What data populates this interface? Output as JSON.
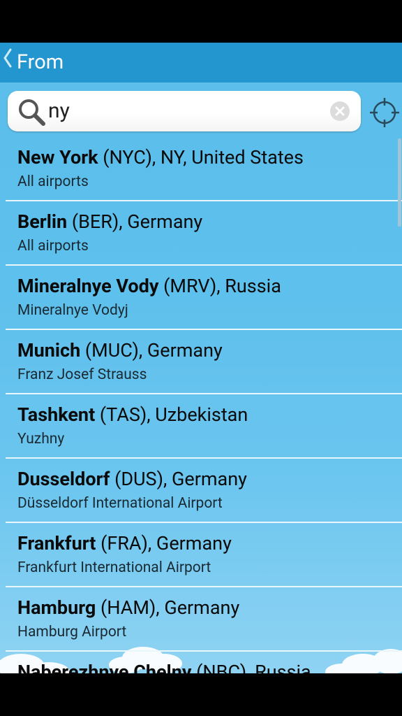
{
  "actionbar": {
    "title": "From"
  },
  "search": {
    "value": "ny"
  },
  "results": [
    {
      "city": "New York",
      "rest": " (NYC), NY, United States",
      "sub": "All airports"
    },
    {
      "city": "Berlin",
      "rest": " (BER), Germany",
      "sub": "All airports"
    },
    {
      "city": "Mineralnye Vody",
      "rest": " (MRV), Russia",
      "sub": "Mineralnye Vodyj"
    },
    {
      "city": "Munich",
      "rest": " (MUC), Germany",
      "sub": "Franz Josef Strauss"
    },
    {
      "city": "Tashkent",
      "rest": " (TAS), Uzbekistan",
      "sub": "Yuzhny"
    },
    {
      "city": "Dusseldorf",
      "rest": " (DUS), Germany",
      "sub": "Düsseldorf International Airport"
    },
    {
      "city": "Frankfurt",
      "rest": " (FRA), Germany",
      "sub": "Frankfurt International Airport"
    },
    {
      "city": "Hamburg",
      "rest": " (HAM), Germany",
      "sub": "Hamburg Airport"
    },
    {
      "city": "Naberezhnye Chelny",
      "rest": " (NBC), Russia",
      "sub": ""
    }
  ],
  "icons": {
    "back": "chevron-left-icon",
    "search": "search-icon",
    "clear": "clear-icon",
    "locate": "crosshair-icon"
  },
  "colors": {
    "actionbar": "#2496cf",
    "background": "#5ec0ec",
    "divider": "#e9f6fc"
  }
}
